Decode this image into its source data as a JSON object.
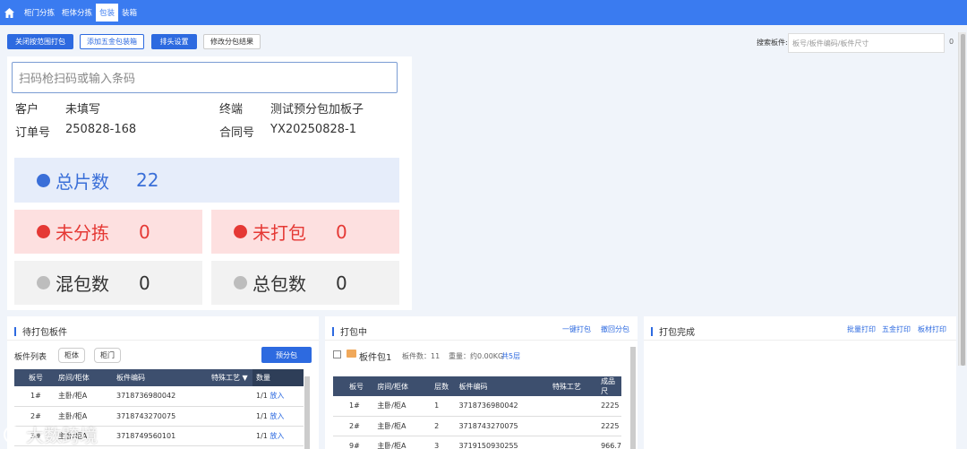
{
  "nav": {
    "tabs": [
      {
        "label": "柜门分拣"
      },
      {
        "label": "柜体分拣"
      },
      {
        "label": "包装"
      },
      {
        "label": "装箱"
      }
    ]
  },
  "toolbar": {
    "close_range": "关闭按范围打包",
    "add_hardware": "添加五金包装箱",
    "header_settings": "排头设置",
    "modify_result": "修改分包结果",
    "search_label": "搜索板件:",
    "search_placeholder": "板号/板件编码/板件尺寸",
    "search_count": "0"
  },
  "scan": {
    "placeholder": "扫码枪扫码或输入条码"
  },
  "info": {
    "customer_label": "客户",
    "customer_value": "未填写",
    "terminal_label": "终端",
    "terminal_value": "测试预分包加板子",
    "order_label": "订单号",
    "order_value": "250828-168",
    "contract_label": "合同号",
    "contract_value": "YX20250828-1"
  },
  "stats": {
    "total": {
      "label": "总片数",
      "value": "22"
    },
    "unsorted": {
      "label": "未分拣",
      "value": "0"
    },
    "unpacked": {
      "label": "未打包",
      "value": "0"
    },
    "mixed": {
      "label": "混包数",
      "value": "0"
    },
    "packages": {
      "label": "总包数",
      "value": "0"
    }
  },
  "pending": {
    "title": "待打包板件",
    "list_label": "板件列表",
    "filter_cabinet": "柜体",
    "filter_door": "柜门",
    "prepack_button": "预分包",
    "columns": [
      "板号",
      "房间/柜体",
      "板件编码",
      "特殊工艺",
      "数量"
    ],
    "rows": [
      {
        "no": "1#",
        "room": "主卧/柜A",
        "code": "3718736980042",
        "qty": "1/1",
        "action": "放入"
      },
      {
        "no": "2#",
        "room": "主卧/柜A",
        "code": "3718743270075",
        "qty": "1/1",
        "action": "放入"
      },
      {
        "no": "3#",
        "room": "主卧/柜A",
        "code": "3718749560101",
        "qty": "1/1",
        "action": "放入"
      }
    ]
  },
  "packing": {
    "title": "打包中",
    "one_click": "一键打包",
    "withdraw": "撤回分包",
    "package_name": "板件包1",
    "count_text": "板件数：11",
    "weight_text": "重量：约0.00KG",
    "layers_text": "共5层",
    "columns": [
      "板号",
      "房间/柜体",
      "层数",
      "板件编码",
      "特殊工艺",
      "成品尺"
    ],
    "rows": [
      {
        "no": "1#",
        "room": "主卧/柜A",
        "layer": "1",
        "code": "3718736980042",
        "size": "2225"
      },
      {
        "no": "2#",
        "room": "主卧/柜A",
        "layer": "2",
        "code": "3718743270075",
        "size": "2225"
      },
      {
        "no": "9#",
        "room": "主卧/柜A",
        "layer": "3",
        "code": "3719150930255",
        "size": "966.7"
      }
    ]
  },
  "done": {
    "title": "打包完成",
    "batch_print": "批量打印",
    "hardware_print": "五金打印",
    "board_print": "板材打印"
  },
  "watermark": "大数跨境",
  "colors": {
    "accent": "#3a7bf0",
    "blue_dot": "#3a6fd8",
    "red_dot": "#e53935",
    "gray_dot": "#bdbdbd"
  }
}
